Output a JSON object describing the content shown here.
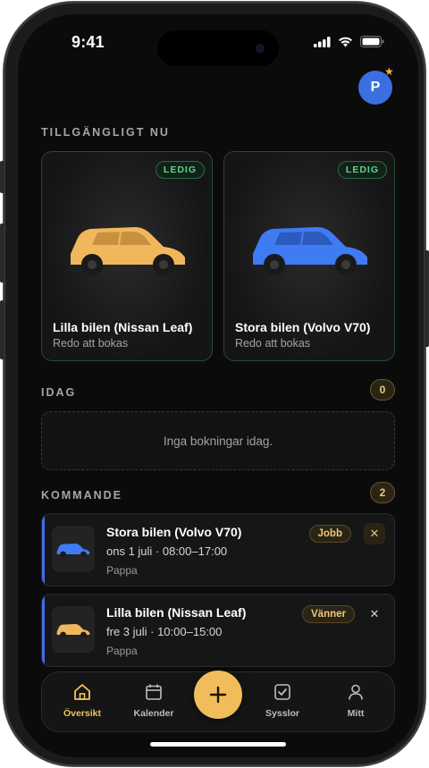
{
  "status_bar": {
    "time": "9:41"
  },
  "profile": {
    "initial": "P"
  },
  "available": {
    "section_label": "TILLGÄNGLIGT NU",
    "cars": [
      {
        "name": "Lilla bilen (Nissan Leaf)",
        "status": "Redo att bokas",
        "badge": "LEDIG",
        "color": "#f0b75c"
      },
      {
        "name": "Stora bilen (Volvo V70)",
        "status": "Redo att bokas",
        "badge": "LEDIG",
        "color": "#3f7cf4"
      }
    ]
  },
  "today": {
    "section_label": "IDAG",
    "count": "0",
    "empty_text": "Inga bokningar idag."
  },
  "upcoming": {
    "section_label": "KOMMANDE",
    "count": "2",
    "bookings": [
      {
        "title": "Stora bilen (Volvo V70)",
        "when": "ons 1 juli · 08:00–17:00",
        "who": "Pappa",
        "tag": "Jobb",
        "car_color": "#3f7cf4"
      },
      {
        "title": "Lilla bilen (Nissan Leaf)",
        "when": "fre 3 juli · 10:00–15:00",
        "who": "Pappa",
        "tag": "Vänner",
        "car_color": "#f0b75c"
      }
    ]
  },
  "tabbar": {
    "tabs": [
      {
        "label": "Översikt",
        "icon": "home-icon",
        "active": true
      },
      {
        "label": "Kalender",
        "icon": "calendar-icon",
        "active": false
      },
      {
        "label": "Sysslor",
        "icon": "checkbox-icon",
        "active": false
      },
      {
        "label": "Mitt",
        "icon": "person-icon",
        "active": false
      }
    ],
    "fab_icon": "plus-icon"
  },
  "colors": {
    "accent": "#f0bd5a",
    "free_green": "#5fd18c",
    "booking_accent": "#3d6fe8",
    "background": "#0b0b0c"
  }
}
